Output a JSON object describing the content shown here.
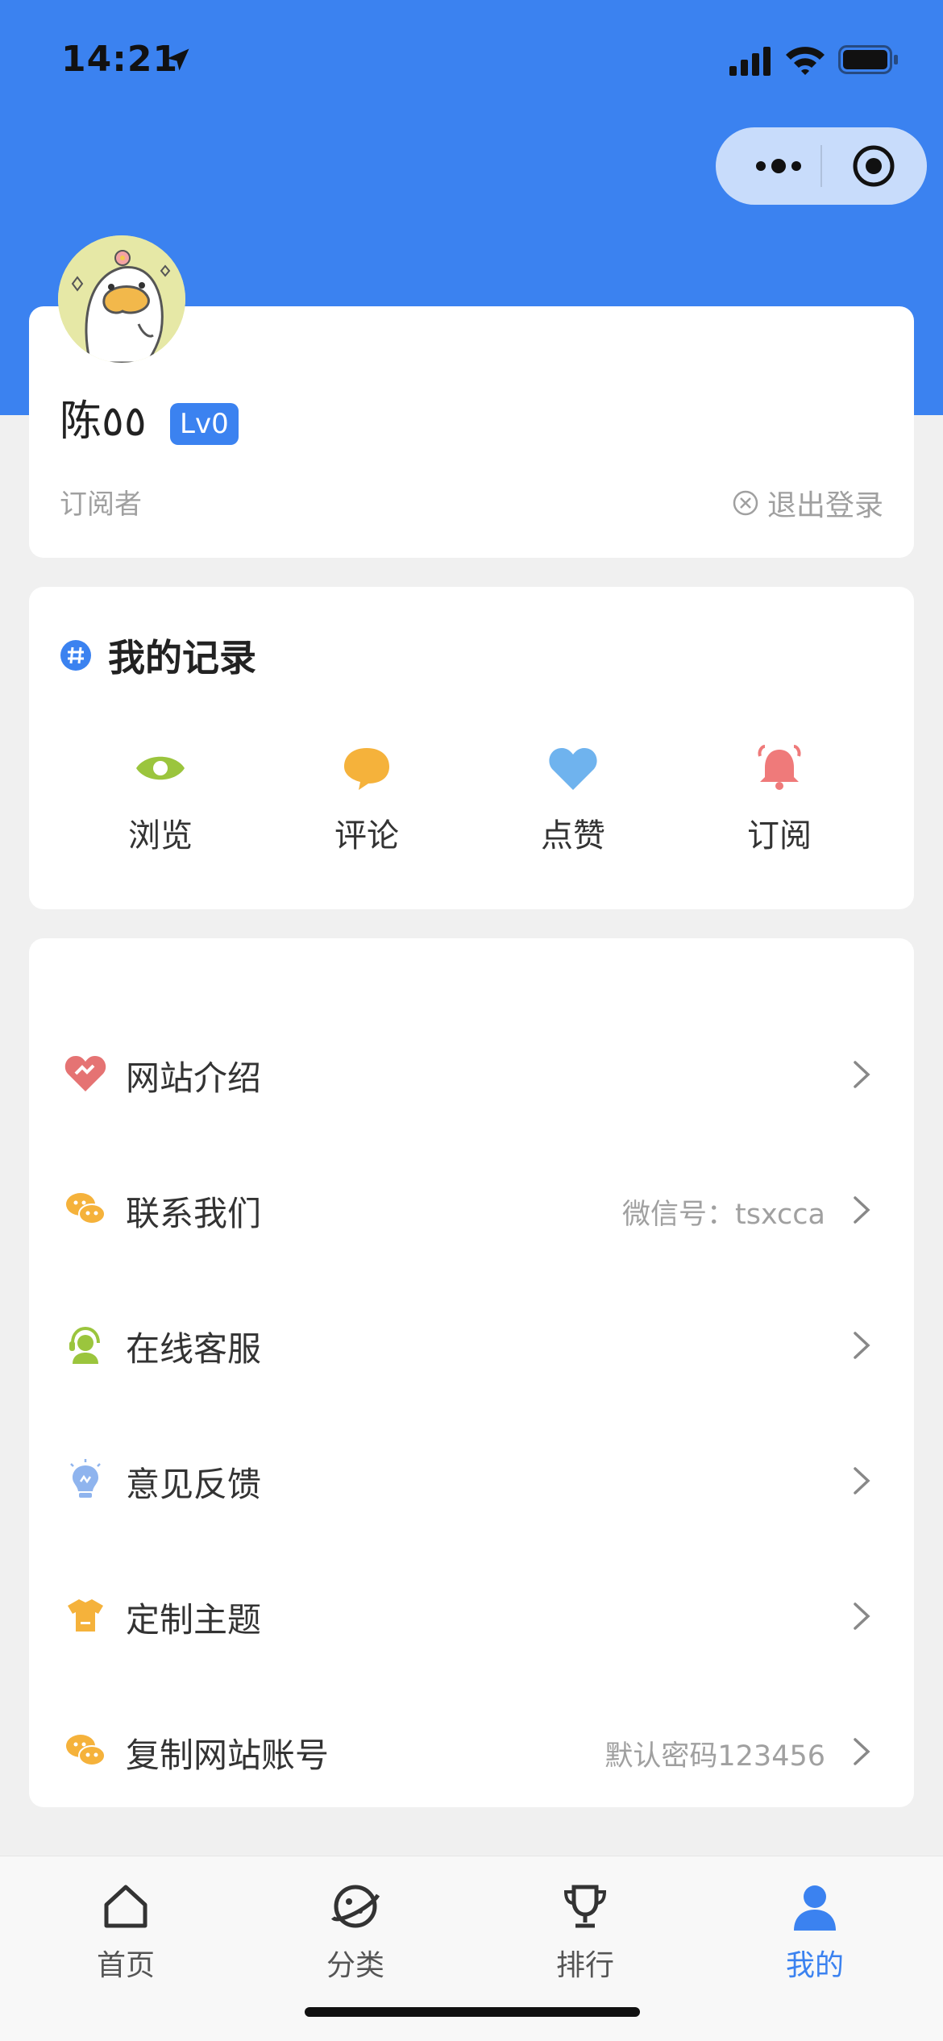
{
  "status_bar": {
    "time": "14:21"
  },
  "profile": {
    "username": "陈٥٥",
    "level": "Lv0",
    "role": "订阅者",
    "logout_label": "退出登录"
  },
  "records": {
    "title": "我的记录",
    "items": [
      {
        "label": "浏览",
        "icon": "eye-icon",
        "color": "#9bc53d"
      },
      {
        "label": "评论",
        "icon": "comment-icon",
        "color": "#f5b23b"
      },
      {
        "label": "点赞",
        "icon": "heart-icon",
        "color": "#6fb3ee"
      },
      {
        "label": "订阅",
        "icon": "bell-icon",
        "color": "#ef7a7a"
      }
    ]
  },
  "menu": {
    "items": [
      {
        "label": "网站介绍",
        "extra": "",
        "icon": "heart-handshake-icon"
      },
      {
        "label": "联系我们",
        "extra": "微信号：tsxcca",
        "icon": "wechat-icon"
      },
      {
        "label": "在线客服",
        "extra": "",
        "icon": "customer-service-icon"
      },
      {
        "label": "意见反馈",
        "extra": "",
        "icon": "lightbulb-icon"
      },
      {
        "label": "定制主题",
        "extra": "",
        "icon": "tshirt-icon"
      },
      {
        "label": "复制网站账号",
        "extra": "默认密码123456",
        "icon": "wechat-icon"
      }
    ]
  },
  "tabbar": {
    "items": [
      {
        "label": "首页",
        "icon": "home-icon",
        "active": false
      },
      {
        "label": "分类",
        "icon": "planet-icon",
        "active": false
      },
      {
        "label": "排行",
        "icon": "trophy-icon",
        "active": false
      },
      {
        "label": "我的",
        "icon": "user-icon",
        "active": true
      }
    ]
  },
  "colors": {
    "brand": "#3b82f0",
    "background": "#f0f0f0"
  }
}
